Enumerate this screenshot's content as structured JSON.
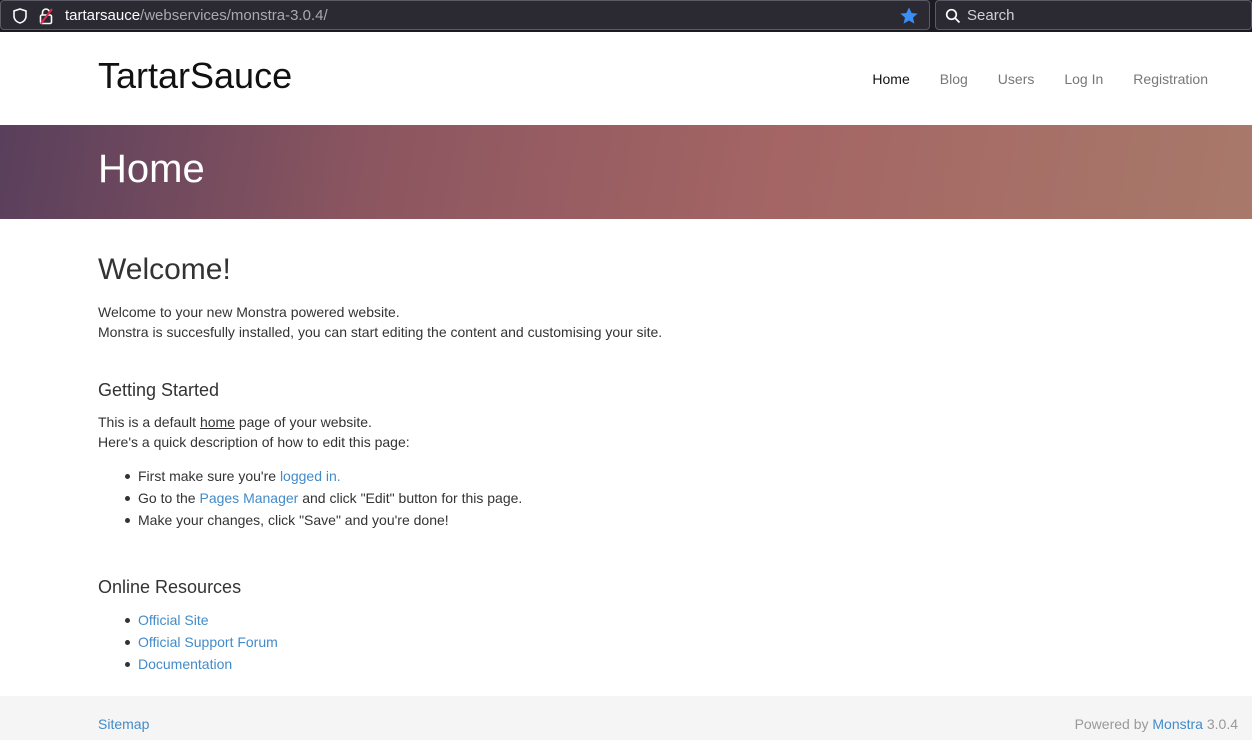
{
  "browser": {
    "url_host": "tartarsauce",
    "url_path": "/webservices/monstra-3.0.4/",
    "search_placeholder": "Search",
    "icons": [
      "shield-icon",
      "lock-icon",
      "star-icon",
      "search-icon"
    ],
    "star_color": "#3a8ef6"
  },
  "site": {
    "brand": "TartarSauce",
    "nav": [
      {
        "label": "Home",
        "active": true
      },
      {
        "label": "Blog",
        "active": false
      },
      {
        "label": "Users",
        "active": false
      },
      {
        "label": "Log In",
        "active": false
      },
      {
        "label": "Registration",
        "active": false
      }
    ],
    "hero_title": "Home"
  },
  "content": {
    "welcome_heading": "Welcome!",
    "welcome_line1": "Welcome to your new Monstra powered website.",
    "welcome_line2": "Monstra is succesfully installed, you can start editing the content and customising your site.",
    "getting_started_heading": "Getting Started",
    "gs_line1_pre": "This is a default ",
    "gs_line1_link": "home",
    "gs_line1_post": " page of your website.",
    "gs_line2": "Here's a quick description of how to edit this page:",
    "steps": [
      {
        "pre": "First make sure you're ",
        "link": "logged in.",
        "post": ""
      },
      {
        "pre": "Go to the ",
        "link": "Pages Manager",
        "post": " and click \"Edit\" button for this page."
      },
      {
        "pre": "Make your changes, click \"Save\" and you're done!",
        "link": "",
        "post": ""
      }
    ],
    "resources_heading": "Online Resources",
    "resources": [
      "Official Site",
      "Official Support Forum",
      "Documentation"
    ]
  },
  "footer": {
    "sitemap": "Sitemap",
    "powered_pre": "Powered by ",
    "powered_link": "Monstra",
    "powered_version": " 3.0.4"
  },
  "colors": {
    "link": "#428bca",
    "chrome_bg": "#1c1b22"
  }
}
